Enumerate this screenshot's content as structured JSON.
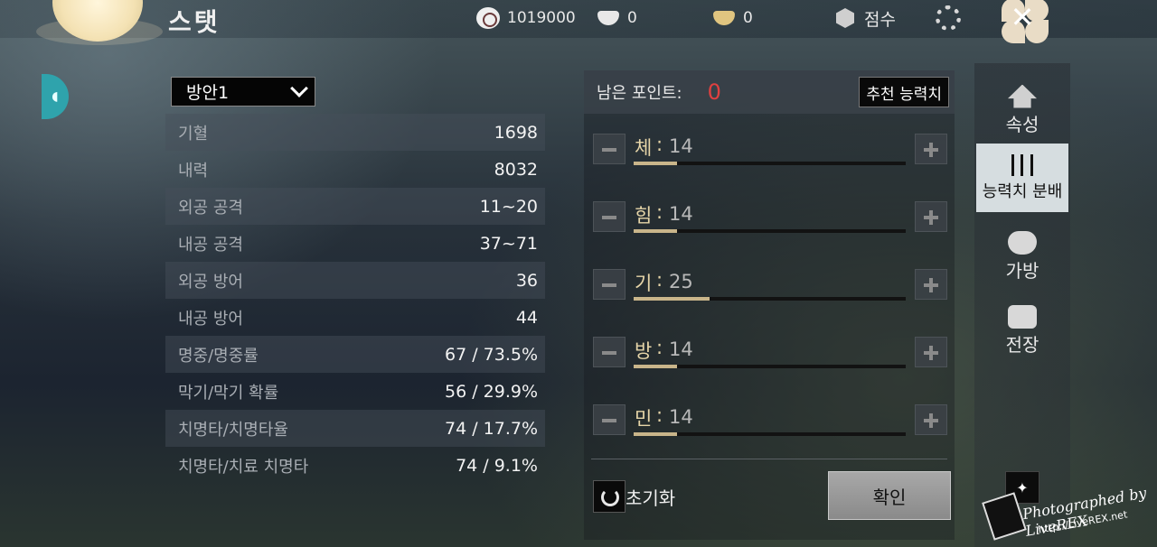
{
  "header": {
    "title": "스탯",
    "currencies": [
      {
        "icon": "coin-icon",
        "value": "1019000"
      },
      {
        "icon": "silver-bowl-icon",
        "value": "0"
      },
      {
        "icon": "gold-bowl-icon",
        "value": "0"
      }
    ],
    "score_label": "점수"
  },
  "plan_select": {
    "value": "방안1"
  },
  "stats": [
    {
      "label": "기혈",
      "value": "1698"
    },
    {
      "label": "내력",
      "value": "8032"
    },
    {
      "label": "외공 공격",
      "value": "11~20"
    },
    {
      "label": "내공 공격",
      "value": "37~71"
    },
    {
      "label": "외공 방어",
      "value": "36"
    },
    {
      "label": "내공 방어",
      "value": "44"
    },
    {
      "label": "명중/명중률",
      "value": "67 / 73.5%"
    },
    {
      "label": "막기/막기 확률",
      "value": "56 / 29.9%"
    },
    {
      "label": "치명타/치명타율",
      "value": "74 / 17.7%"
    },
    {
      "label": "치명타/치료 치명타",
      "value": "74 / 9.1%"
    }
  ],
  "allocation": {
    "points_label": "남은 포인트:",
    "points_value": "0",
    "recommend_label": "추천 능력치",
    "attributes": [
      {
        "name": "체",
        "colon": ":",
        "value": "14",
        "fill": 0.16
      },
      {
        "name": "힘",
        "colon": ":",
        "value": "14",
        "fill": 0.16
      },
      {
        "name": "기",
        "colon": ":",
        "value": "25",
        "fill": 0.28
      },
      {
        "name": "방",
        "colon": ":",
        "value": "14",
        "fill": 0.16
      },
      {
        "name": "민",
        "colon": ":",
        "value": "14",
        "fill": 0.16
      }
    ],
    "reset_label": "초기화",
    "confirm_label": "확인"
  },
  "sidenav": {
    "items": [
      {
        "label": "속성"
      },
      {
        "label": "능력치 분배"
      },
      {
        "label": "가방"
      },
      {
        "label": "전장"
      }
    ]
  },
  "watermark": {
    "text": "Photographed by LiveREX",
    "url": "http://LiveREX.net"
  },
  "colors": {
    "accent_gold": "#c9b58a",
    "points_red": "#e04040",
    "teal": "#2fa3ac"
  }
}
